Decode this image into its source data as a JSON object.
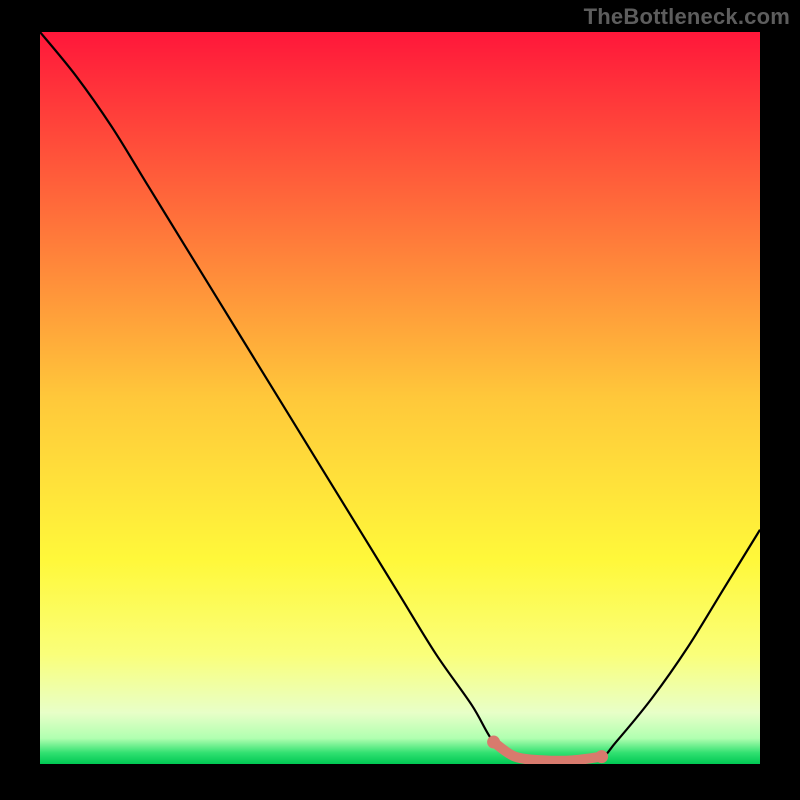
{
  "attribution": "TheBottleneck.com",
  "chart_data": {
    "type": "line",
    "title": "",
    "xlabel": "",
    "ylabel": "",
    "xlim": [
      0,
      100
    ],
    "ylim": [
      0,
      100
    ],
    "series": [
      {
        "name": "curve",
        "x": [
          0,
          5,
          10,
          15,
          20,
          25,
          30,
          35,
          40,
          45,
          50,
          55,
          60,
          63,
          66,
          70,
          74,
          78,
          80,
          85,
          90,
          95,
          100
        ],
        "y": [
          100,
          94,
          87,
          79,
          71,
          63,
          55,
          47,
          39,
          31,
          23,
          15,
          8,
          3,
          1,
          0.5,
          0.5,
          1,
          3,
          9,
          16,
          24,
          32
        ]
      },
      {
        "name": "highlight",
        "x": [
          63,
          66,
          70,
          74,
          78
        ],
        "y": [
          3,
          1,
          0.5,
          0.5,
          1
        ]
      }
    ],
    "gradient_stops": [
      {
        "offset": 0.0,
        "color": "#ff173a"
      },
      {
        "offset": 0.25,
        "color": "#ff6f3a"
      },
      {
        "offset": 0.5,
        "color": "#ffc83a"
      },
      {
        "offset": 0.72,
        "color": "#fff83a"
      },
      {
        "offset": 0.85,
        "color": "#faff7a"
      },
      {
        "offset": 0.93,
        "color": "#e8ffc8"
      },
      {
        "offset": 0.965,
        "color": "#b0ffb0"
      },
      {
        "offset": 0.985,
        "color": "#30e070"
      },
      {
        "offset": 1.0,
        "color": "#00c853"
      }
    ],
    "colors": {
      "curve": "#000000",
      "highlight": "#d87a6d",
      "background": "#000000",
      "attribution": "#5d5d5d"
    }
  }
}
